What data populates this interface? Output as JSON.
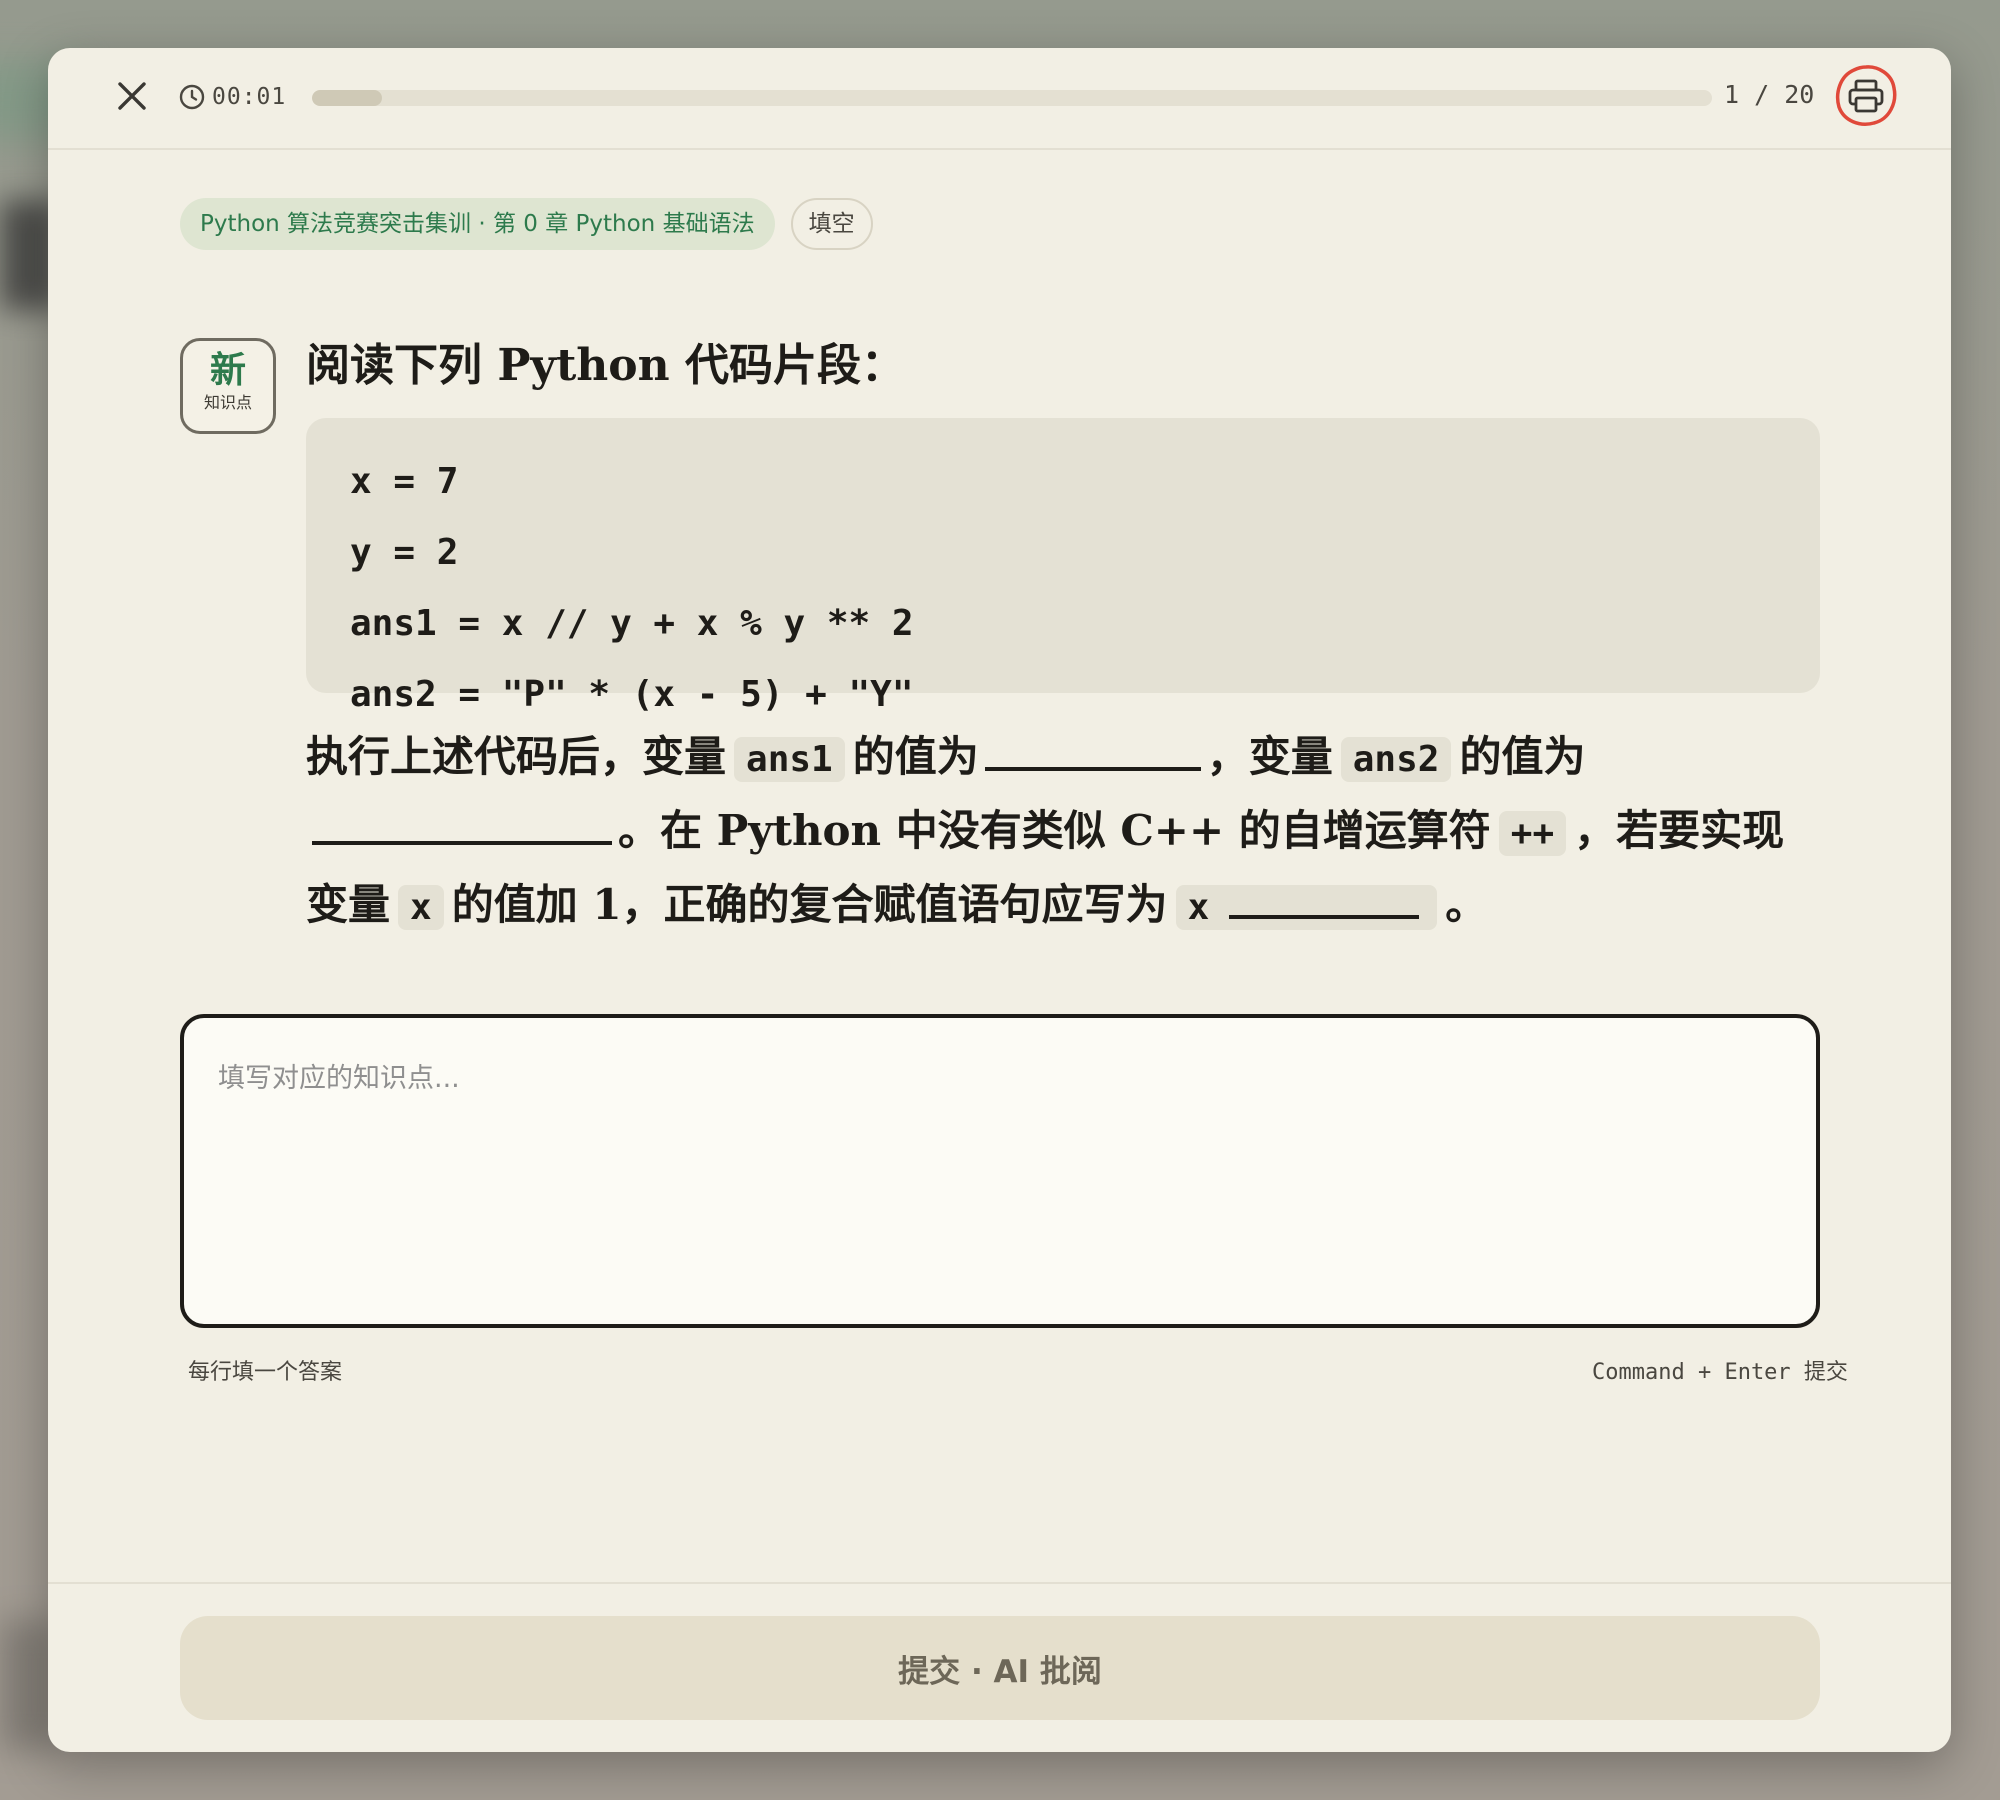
{
  "header": {
    "timer": "00:01",
    "counter": "1 / 20",
    "progress_fraction": 0.05
  },
  "tags": {
    "course": "Python 算法竞赛突击集训 · 第 0 章 Python 基础语法",
    "type": "填空"
  },
  "badge": {
    "main": "新",
    "sub": "知识点"
  },
  "question": {
    "title": "阅读下列 Python 代码片段：",
    "code_lines": [
      "x = 7",
      "y = 2",
      "ans1 = x // y + x % y ** 2",
      "ans2 = \"P\" * (x - 5) + \"Y\""
    ],
    "body": {
      "p1": "执行上述代码后，变量",
      "c1": "ans1",
      "p2": "的值为",
      "p3": "，变量",
      "c2": "ans2",
      "p4": "的值为",
      "p5": "。在 Python 中没有类似 C++ 的自增运算符",
      "c3": "++",
      "p6": "，若要实现变量",
      "c4": "x",
      "p7": "的值加 1，正确的复合赋值语句应写为",
      "c5": "x",
      "p8": "。"
    }
  },
  "answer": {
    "placeholder": "填写对应的知识点..."
  },
  "hints": {
    "left": "每行填一个答案",
    "right": "Command + Enter 提交"
  },
  "submit": {
    "label": "提交 · AI 批阅"
  },
  "colors": {
    "accent_green": "#2d7a4c",
    "highlight_red": "#e0493a",
    "panel_bg": "#f2efe4"
  },
  "icons": {
    "close": "close-icon",
    "timer": "clock-icon",
    "print": "printer-icon"
  }
}
